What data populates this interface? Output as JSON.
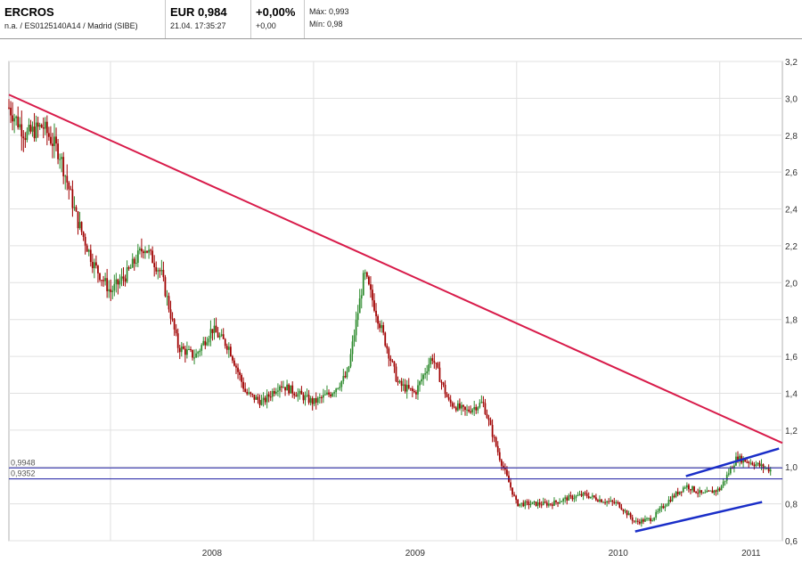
{
  "header": {
    "name": "ERCROS",
    "subtitle": "n.a. / ES0125140A14 / Madrid (SIBE)",
    "price": "EUR 0,984",
    "datetime": "21.04. 17:35:27",
    "change_pct": "+0,00%",
    "change_abs": "+0,00",
    "high": "Máx: 0,993",
    "low": "Mín: 0,98"
  },
  "colors": {
    "up": "#2e8b2e",
    "down": "#a00000",
    "trend_main": "#d81b4a",
    "channel": "#1a2ec8",
    "hline": "#1a1aa0",
    "grid": "#e0e0e0"
  },
  "chart_data": {
    "type": "candlestick",
    "x_ticks": [
      "2008",
      "2009",
      "2010",
      "2011"
    ],
    "y_ticks": [
      "3,2",
      "3,0",
      "2,8",
      "2,6",
      "2,4",
      "2,2",
      "2,0",
      "1,8",
      "1,6",
      "1,4",
      "1,2",
      "1,0",
      "0,8",
      "0,6"
    ],
    "ylim": [
      0.6,
      3.2
    ],
    "x_range": [
      "2007-07",
      "2011-04"
    ],
    "grid": true,
    "price_path": [
      [
        "2007-07",
        2.95
      ],
      [
        "2007-08",
        2.8
      ],
      [
        "2007-09",
        2.85
      ],
      [
        "2007-10",
        2.7
      ],
      [
        "2007-11",
        2.35
      ],
      [
        "2007-12",
        2.1
      ],
      [
        "2008-01",
        1.95
      ],
      [
        "2008-02",
        2.05
      ],
      [
        "2008-03",
        2.2
      ],
      [
        "2008-04",
        2.05
      ],
      [
        "2008-05",
        1.65
      ],
      [
        "2008-06",
        1.6
      ],
      [
        "2008-07",
        1.75
      ],
      [
        "2008-08",
        1.65
      ],
      [
        "2008-09",
        1.4
      ],
      [
        "2008-10",
        1.35
      ],
      [
        "2008-11",
        1.45
      ],
      [
        "2008-12",
        1.4
      ],
      [
        "2009-01",
        1.35
      ],
      [
        "2009-02",
        1.4
      ],
      [
        "2009-03",
        1.5
      ],
      [
        "2009-04",
        2.05
      ],
      [
        "2009-05",
        1.75
      ],
      [
        "2009-06",
        1.45
      ],
      [
        "2009-07",
        1.4
      ],
      [
        "2009-08",
        1.6
      ],
      [
        "2009-09",
        1.35
      ],
      [
        "2009-10",
        1.3
      ],
      [
        "2009-11",
        1.35
      ],
      [
        "2009-12",
        1.05
      ],
      [
        "2010-01",
        0.8
      ],
      [
        "2010-02",
        0.8
      ],
      [
        "2010-03",
        0.8
      ],
      [
        "2010-04",
        0.83
      ],
      [
        "2010-05",
        0.85
      ],
      [
        "2010-06",
        0.82
      ],
      [
        "2010-07",
        0.8
      ],
      [
        "2010-08",
        0.7
      ],
      [
        "2010-09",
        0.72
      ],
      [
        "2010-10",
        0.82
      ],
      [
        "2010-11",
        0.9
      ],
      [
        "2010-12",
        0.85
      ],
      [
        "2011-01",
        0.88
      ],
      [
        "2011-02",
        1.05
      ],
      [
        "2011-03",
        1.02
      ],
      [
        "2011-04",
        0.984
      ]
    ],
    "horizontal_lines": [
      {
        "label": "0,9948",
        "value": 0.9948
      },
      {
        "label": "0,9352",
        "value": 0.9352
      }
    ],
    "trend_lines": [
      {
        "name": "downtrend",
        "from": [
          "2007-07",
          3.02
        ],
        "to": [
          "2011-04",
          1.13
        ]
      },
      {
        "name": "channel-upper",
        "from": [
          "2010-11",
          0.95
        ],
        "to": [
          "2011-04",
          1.1
        ]
      },
      {
        "name": "channel-lower",
        "from": [
          "2010-08",
          0.65
        ],
        "to": [
          "2011-03",
          0.81
        ]
      }
    ]
  }
}
